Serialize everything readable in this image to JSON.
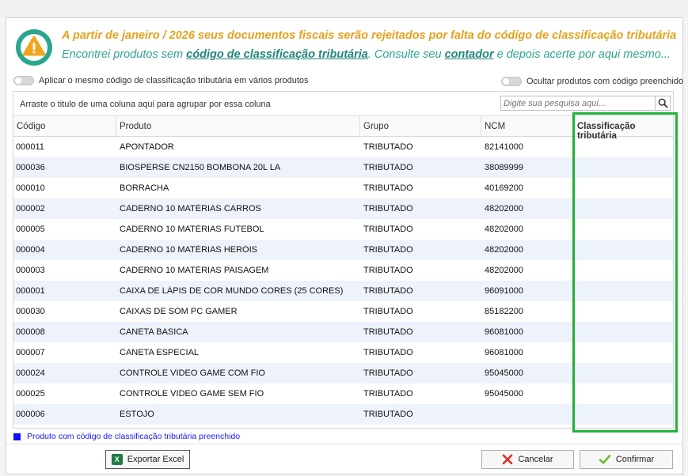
{
  "banner": {
    "line1": "A partir de janeiro / 2026 seus documentos fiscais serão rejeitados por falta do código de classificação tributária",
    "line2_part1": "Encontrei produtos sem ",
    "line2_link1": "código de classificação tributária",
    "line2_part2": ". Consulte seu ",
    "line2_link2": "contador",
    "line2_part3": " e depois acerte por aqui mesmo..."
  },
  "toggles": {
    "apply_same": "Aplicar o mesmo código de classificação tributária em vários produtos",
    "hide_filled": "Ocultar produtos com código preenchido"
  },
  "grid": {
    "group_hint": "Arraste o titulo de uma coluna aqui para agrupar por essa coluna",
    "search_placeholder": "Digite sua pesquisa aqui...",
    "columns": {
      "code": "Código",
      "product": "Produto",
      "group": "Grupo",
      "ncm": "NCM",
      "classification": "Classificação tributária"
    },
    "rows": [
      {
        "code": "000011",
        "product": "APONTADOR",
        "group": "TRIBUTADO",
        "ncm": "82141000",
        "classification": ""
      },
      {
        "code": "000036",
        "product": "BIOSPERSE CN2150 BOMBONA 20L LA",
        "group": "TRIBUTADO",
        "ncm": "38089999",
        "classification": ""
      },
      {
        "code": "000010",
        "product": "BORRACHA",
        "group": "TRIBUTADO",
        "ncm": "40169200",
        "classification": ""
      },
      {
        "code": "000002",
        "product": "CADERNO 10 MATÉRIAS CARROS",
        "group": "TRIBUTADO",
        "ncm": "48202000",
        "classification": ""
      },
      {
        "code": "000005",
        "product": "CADERNO 10 MATÉRIAS FUTEBOL",
        "group": "TRIBUTADO",
        "ncm": "48202000",
        "classification": ""
      },
      {
        "code": "000004",
        "product": "CADERNO 10 MATÉRIAS HERÓIS",
        "group": "TRIBUTADO",
        "ncm": "48202000",
        "classification": ""
      },
      {
        "code": "000003",
        "product": "CADERNO 10 MATÉRIAS PAISAGEM",
        "group": "TRIBUTADO",
        "ncm": "48202000",
        "classification": ""
      },
      {
        "code": "000001",
        "product": "CAIXA DE LÁPIS DE COR MUNDO CORES (25 CORES)",
        "group": "TRIBUTADO",
        "ncm": "96091000",
        "classification": ""
      },
      {
        "code": "000030",
        "product": "CAIXAS DE SOM PC GAMER",
        "group": "TRIBUTADO",
        "ncm": "85182200",
        "classification": ""
      },
      {
        "code": "000008",
        "product": "CANETA BASICA",
        "group": "TRIBUTADO",
        "ncm": "96081000",
        "classification": ""
      },
      {
        "code": "000007",
        "product": "CANETA ESPECIAL",
        "group": "TRIBUTADO",
        "ncm": "96081000",
        "classification": ""
      },
      {
        "code": "000024",
        "product": "CONTROLE VIDEO GAME COM FIO",
        "group": "TRIBUTADO",
        "ncm": "95045000",
        "classification": ""
      },
      {
        "code": "000025",
        "product": "CONTROLE VIDEO GAME SEM FIO",
        "group": "TRIBUTADO",
        "ncm": "95045000",
        "classification": ""
      },
      {
        "code": "000006",
        "product": "ESTOJO",
        "group": "TRIBUTADO",
        "ncm": "",
        "classification": ""
      }
    ]
  },
  "legend": {
    "text": "Produto com código de classificação tributária preenchido",
    "color": "#1010ff"
  },
  "buttons": {
    "export_excel": "Exportar Excel",
    "cancel": "Cancelar",
    "confirm": "Confirmar"
  },
  "colors": {
    "warning": "#e6a11f",
    "teal": "#2ea593",
    "highlight": "#21b33a",
    "alt_row": "#eef2fb"
  },
  "icons": {
    "warning": "warning-icon",
    "search": "search-icon",
    "excel": "excel-icon",
    "cancel": "cancel-x-icon",
    "confirm": "check-icon"
  }
}
